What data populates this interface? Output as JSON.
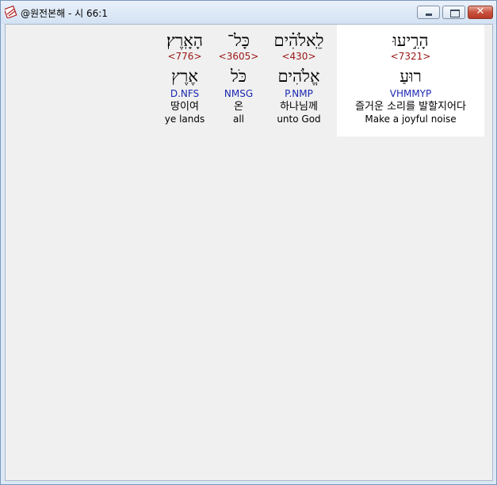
{
  "window": {
    "title": "@원전본해 - 시 66:1",
    "controls": {
      "minimize": "",
      "maximize": "",
      "close": "✕"
    }
  },
  "words": [
    {
      "hebrew": "הָרִ֣יעוּ",
      "strong": "<7321>",
      "lemma": "רוּעַ",
      "morph": "VHMMYP",
      "korean": "즐거운 소리를 발할지어다",
      "english": "Make a joyful noise"
    },
    {
      "hebrew": "לֵֽאלֹהִ֗ים",
      "strong": "<430>",
      "lemma": "אֱלֹהִים",
      "morph": "P.NMP",
      "korean": "하나님께",
      "english": "unto God"
    },
    {
      "hebrew": "כָּל־",
      "strong": "<3605>",
      "lemma": "כֹּל",
      "morph": "NMSG",
      "korean": "온",
      "english": "all"
    },
    {
      "hebrew": "הָאָֽרֶץ׃",
      "strong": "<776>",
      "lemma": "אֶרֶץ",
      "morph": "D.NFS",
      "korean": "땅이여",
      "english": "ye lands"
    }
  ]
}
